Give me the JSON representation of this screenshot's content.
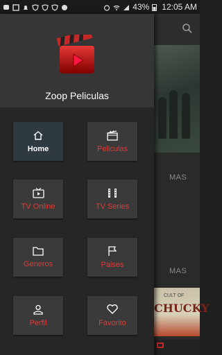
{
  "status_bar": {
    "battery": "43%",
    "time": "12:05 AM"
  },
  "app": {
    "title": "Zoop Peliculas"
  },
  "menu": [
    {
      "label": "Home",
      "icon": "home-icon",
      "active": true
    },
    {
      "label": "Peliculas",
      "icon": "film-icon",
      "active": false
    },
    {
      "label": "TV Online",
      "icon": "tv-icon",
      "active": false
    },
    {
      "label": "TV Series",
      "icon": "film-strip-icon",
      "active": false
    },
    {
      "label": "Generos",
      "icon": "folder-icon",
      "active": false
    },
    {
      "label": "Paises",
      "icon": "flag-icon",
      "active": false
    },
    {
      "label": "Perfil",
      "icon": "person-icon",
      "active": false
    },
    {
      "label": "Favorito",
      "icon": "heart-icon",
      "active": false
    }
  ],
  "background": {
    "mas_1": "MAS",
    "mas_2": "MAS",
    "poster_small": "CULT OF",
    "poster_big": "CHUCKY"
  },
  "colors": {
    "accent": "#e53935",
    "drawer_bg": "#262626",
    "tile_bg": "#3a3a3a"
  }
}
